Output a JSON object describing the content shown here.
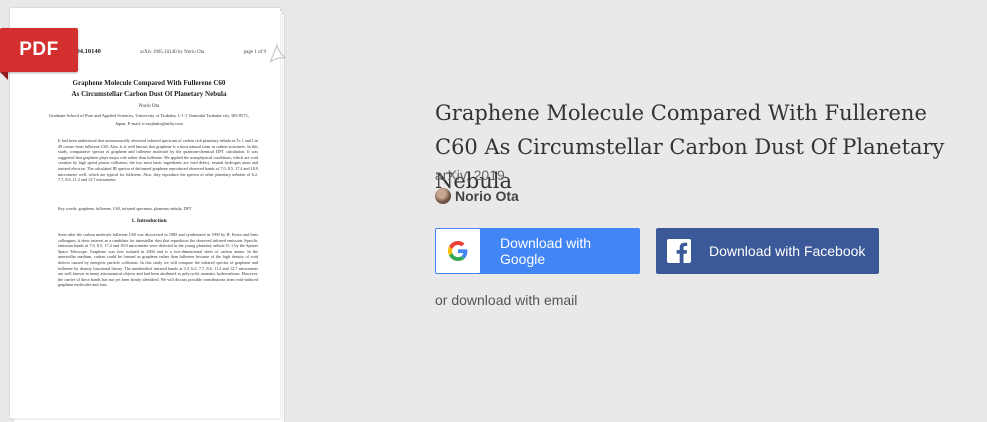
{
  "preview": {
    "badge": "PDF",
    "doc_id": "1904.10140",
    "doc_header_info": "arXiv 1905.10140   by Norio Ota",
    "doc_page": "page 1 of 9",
    "doc_title_line1": "Graphene Molecule Compared With Fullerene C60",
    "doc_title_line2": "As Circumstellar Carbon Dust Of Planetary Nebula",
    "doc_author": "Norio Ota",
    "doc_affiliation": "Graduate School of Pure and Applied Sciences, University of Tsukuba, 1-1-1 Tennodai Tsukuba-city 305-8571, Japan, E-mail: n-otajitaku@nifty.com",
    "doc_abstract": "It had been understood that astronomically observed infrared spectrum of carbon rich planetary nebula as Tc 1 and Lin 49 comes from fullerene C60. Also, it is well known that graphene is a most natural form in carbon structures. In this study, comparative spectra of graphene and fullerene molecule by the quantum-chemical DFT calculation. It was suggested that graphene plays major role rather than fullerene. We applied the astrophysical conditions, which are void creation by high speed proton collisions, the two most basic ingredients are void defect, neutral hydrogen atom and ionized electron. The calculated IR spectra of deformed graphene reproduced observed bands of 7.0, 8.5, 17.4 and 18.9 micrometer well, which are typical for fullerene. Also, they reproduce the spectra of other planetary nebulae of 6.2, 7.7, 8.6, 11.2 and 12.7 micrometer.",
    "doc_keywords": "Key words: graphene, fullerene, C60, infrared spectrum, planetary nebula, DFT",
    "doc_section": "1. Introduction",
    "doc_body": "Soon after the carbon molecule fullerene C60 was discovered in 1985 and synthesized in 1990 by H. Kroto and their colleagues, it drew interest as a candidate for interstellar dust that reproduces the observed infrared emission. Specific emission bands at 7.0, 8.5, 17.4 and 18.9 micrometer were detected in the young planetary nebula Tc 1 by the Spitzer Space Telescope. Graphene was first isolated in 2004 and is a two-dimensional sheet of carbon atoms. In the interstellar medium, carbon could be formed as graphene rather than fullerene because of the high density of void defects caused by energetic particle collisions. In this study we will compare the infrared spectra of graphene and fullerene by density functional theory. The unidentified infrared bands at 3.3, 6.2, 7.7, 8.6, 11.2 and 12.7 micrometer are well known in many astronomical objects and had been attributed to polycyclic aromatic hydrocarbons. However, the carrier of these bands has not yet been firmly identified. We will discuss possible contributions from void-induced graphene molecules and ions."
  },
  "paper": {
    "title": "Graphene Molecule Compared With Fullerene C60 As Circumstellar Carbon Dust Of Planetary Nebula",
    "source": "arXiv, 2019",
    "author": "Norio Ota"
  },
  "actions": {
    "google_label": "Download with Google",
    "facebook_label": "Download with Facebook",
    "email_label": "or download with email"
  },
  "colors": {
    "google_blue": "#4285f4",
    "facebook_blue": "#3b5998",
    "pdf_red": "#d32f2f"
  }
}
